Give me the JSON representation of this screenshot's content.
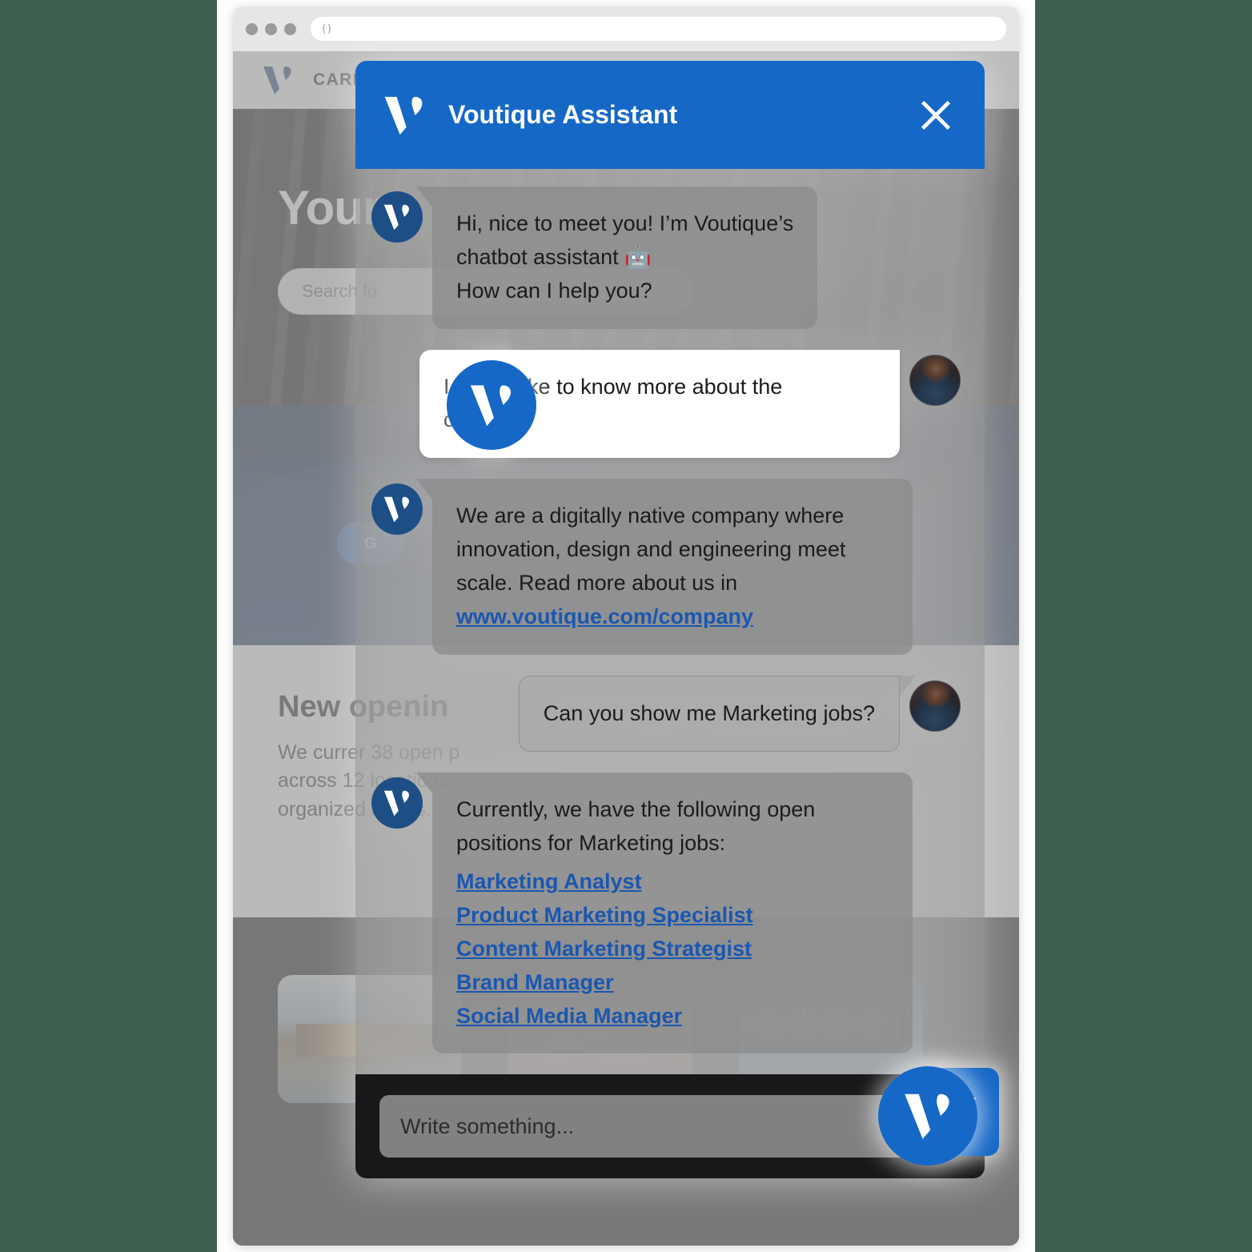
{
  "browser": {
    "url_value": "",
    "nav_back_icon": "chevron-left-icon",
    "nav_forward_icon": "chevron-right-icon"
  },
  "site": {
    "nav": {
      "logo": "voutique-logo",
      "title": "CAREERS"
    },
    "hero": {
      "title": "Your c",
      "search_placeholder": "Search fo"
    },
    "navy_band": {
      "button_label": "G"
    },
    "openings": {
      "title": "New openin",
      "body": "We currer 38 open p across 12 locations organized teams."
    },
    "cities": [
      {
        "name": "london-card"
      },
      {
        "name": "sydney-card"
      },
      {
        "name": "dubai-card"
      }
    ],
    "fab": {
      "icon": "voutique-logo-icon"
    }
  },
  "chat": {
    "header": {
      "logo_icon": "voutique-logo-icon",
      "title": "Voutique Assistant",
      "close_icon": "close-icon"
    },
    "messages": [
      {
        "from": "bot",
        "avatar": "bot-avatar",
        "line1": "Hi, nice to meet you!  I’m Voutique’s",
        "line2": "chatbot assistant 🤖",
        "line3": "How can I help you?"
      },
      {
        "from": "user",
        "avatar": "user-avatar",
        "text": "I would like to know more about the company"
      },
      {
        "from": "bot",
        "avatar": "bot-avatar",
        "text_before": "We are a digitally native company where innovation, design and engineering meet scale. Read more about us in ",
        "link_text": "www.voutique.com/company"
      },
      {
        "from": "user",
        "avatar": "user-avatar",
        "text": "Can you show me Marketing jobs?"
      },
      {
        "from": "bot",
        "avatar": "bot-avatar",
        "intro": "Currently, we have the following open positions for Marketing jobs:",
        "jobs": [
          "Marketing Analyst",
          "Product Marketing Specialist",
          "Content Marketing Strategist",
          "Brand Manager",
          "Social Media Manager"
        ]
      }
    ],
    "footer": {
      "input_placeholder": "Write something...",
      "send_icon": "send-paper-plane-icon"
    }
  },
  "colors": {
    "brand_blue": "#1668c7",
    "bot_avatar_blue": "#1d4f86",
    "link_blue": "#1a57b0",
    "navy": "#0a1e3d",
    "footer_dark": "#18181b"
  }
}
